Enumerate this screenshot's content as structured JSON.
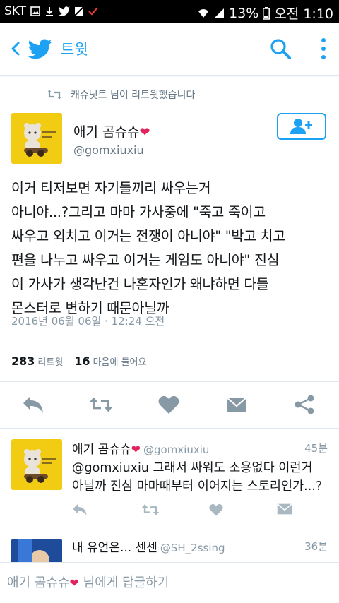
{
  "status_bar": {
    "carrier": "SKT",
    "battery": "13%",
    "time": "오전 1:10"
  },
  "header": {
    "title": "트윗"
  },
  "retweet_context": {
    "text": "캐슈넛트 님이 리트윗했습니다"
  },
  "tweet": {
    "author_name": "애기 곰슈슈",
    "handle": "@gomxiuxiu",
    "text_lines": [
      "이거 티저보면 자기들끼리 싸우는거",
      "아니야...?그리고 마마 가사중에 \"죽고 죽이고",
      "싸우고 외치고 이거는 전쟁이 아니야\" \"박고 치고",
      "편을 나누고 싸우고 이거는 게임도 아니야\" 진심",
      "이 가사가 생각난건 나혼자인가 왜냐하면 다들",
      "몬스터로 변하기 때문아닐까"
    ],
    "timestamp": "2016년 06월 06일 · 12:24 오전",
    "retweet_count": "283",
    "retweet_label": "리트윗",
    "like_count": "16",
    "like_label": "마음에 들어요"
  },
  "replies": [
    {
      "author_name": "애기 곰슈슈",
      "handle": "@gomxiuxiu",
      "time": "45분",
      "text_lines": [
        "@gomxiuxiu 그래서 싸워도 소용없다 이런거",
        "아닐까 진심 마마때부터 이어지는 스토리인가...?"
      ]
    },
    {
      "author_name": "내 유언은... 센센",
      "handle": "@SH_2ssing",
      "time": "36분"
    }
  ],
  "composer": {
    "placeholder_name": "애기 곰슈슈",
    "placeholder_suffix": "님에게 답글하기"
  },
  "colors": {
    "accent": "#1da1f2",
    "heart": "#e0245e",
    "icon_gray": "#8899a6"
  }
}
